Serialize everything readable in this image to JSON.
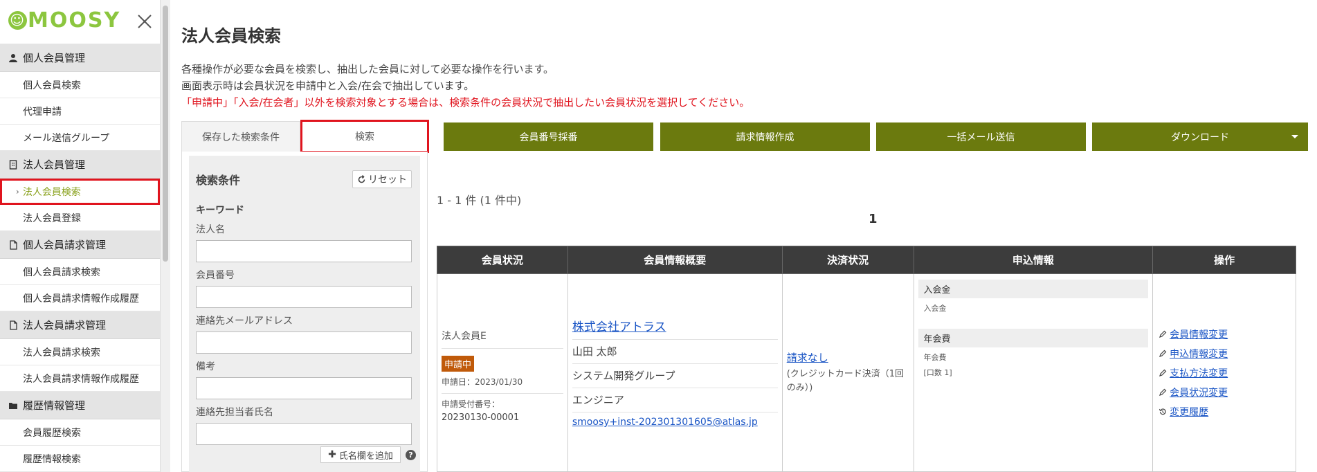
{
  "sidebar": {
    "logo": "SMOOSY",
    "sections": [
      {
        "title": "個人会員管理",
        "icon": "person-icon",
        "items": [
          "個人会員検索",
          "代理申請",
          "メール送信グループ"
        ]
      },
      {
        "title": "法人会員管理",
        "icon": "building-icon",
        "items": [
          "法人会員検索",
          "法人会員登録"
        ]
      },
      {
        "title": "個人会員請求管理",
        "icon": "document-icon",
        "items": [
          "個人会員請求検索",
          "個人会員請求情報作成履歴"
        ]
      },
      {
        "title": "法人会員請求管理",
        "icon": "document-icon",
        "items": [
          "法人会員請求検索",
          "法人会員請求情報作成履歴"
        ]
      },
      {
        "title": "履歴情報管理",
        "icon": "folder-icon",
        "items": [
          "会員履歴検索",
          "履歴情報検索"
        ]
      }
    ],
    "active_item": "法人会員検索"
  },
  "main": {
    "title": "法人会員検索",
    "description": [
      "各種操作が必要な会員を検索し、抽出した会員に対して必要な操作を行います。",
      "画面表示時は会員状況を申請中と入会/在会で抽出しています。"
    ],
    "notice": "「申請中」「入会/在会者」以外を検索対象とする場合は、検索条件の会員状況で抽出したい会員状況を選択してください。",
    "tabs": {
      "saved": "保存した検索条件",
      "search": "検索"
    },
    "search": {
      "title": "検索条件",
      "reset": "リセット",
      "keyword_heading": "キーワード",
      "fields": [
        {
          "label": "法人名",
          "value": ""
        },
        {
          "label": "会員番号",
          "value": ""
        },
        {
          "label": "連絡先メールアドレス",
          "value": ""
        },
        {
          "label": "備考",
          "value": ""
        },
        {
          "label": "連絡先担当者氏名",
          "value": ""
        }
      ],
      "add_name": "氏名欄を追加"
    },
    "actions": [
      "会員番号採番",
      "請求情報作成",
      "一括メール送信",
      "ダウンロード"
    ],
    "result_count": "1 - 1 件 (1 件中)",
    "page": "1",
    "table": {
      "headers": [
        "会員状況",
        "会員情報概要",
        "決済状況",
        "申込情報",
        "操作"
      ],
      "row": {
        "status": "法人会員E",
        "badge": "申請中",
        "apply_date": "申請日：2023/01/30",
        "receipt_label": "申請受付番号：",
        "receipt_no": "20230130-00001",
        "company": "株式会社アトラス",
        "person": "山田 太郎",
        "group": "システム開発グループ",
        "role": "エンジニア",
        "email": "smoosy+inst-202301301605@atlas.jp",
        "payment_link": "請求なし",
        "payment_note": "(クレジットカード決済（1回のみ）)",
        "entry_fee_head": "入会金",
        "entry_fee_sub": "入会金",
        "annual_fee_head": "年会費",
        "annual_fee_sub": "年会費",
        "annual_fee_count": "[口数 1]",
        "operations": [
          "会員情報変更",
          "申込情報変更",
          "支払方法変更",
          "会員状況変更",
          "変更履歴"
        ]
      }
    }
  },
  "colors": {
    "accent": "#6b7a0e",
    "highlight": "#e0141e",
    "badge": "#c05a0a",
    "logo": "#8cc63f"
  }
}
